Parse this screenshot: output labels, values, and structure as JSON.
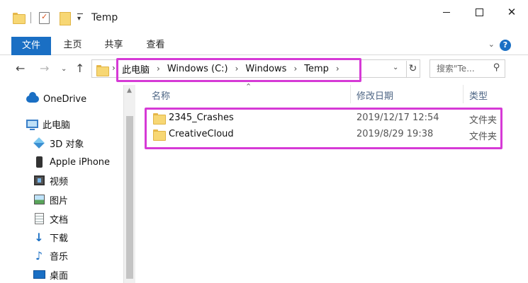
{
  "window": {
    "title": "Temp",
    "controls": {
      "minimize": "",
      "maximize": "",
      "close": "✕"
    }
  },
  "ribbon": {
    "tabs": [
      "文件",
      "主页",
      "共享",
      "查看"
    ],
    "active_tab": "文件",
    "accent": "#1a6fc4"
  },
  "address": {
    "crumbs": [
      "此电脑",
      "Windows (C:)",
      "Windows",
      "Temp"
    ],
    "separator": "›"
  },
  "search": {
    "placeholder": "搜索\"Te..."
  },
  "nav_pane": {
    "items": [
      {
        "label": "OneDrive",
        "icon": "onedrive-cloud-icon"
      },
      {
        "label": "此电脑",
        "icon": "computer-icon"
      },
      {
        "label": "3D 对象",
        "icon": "3d-objects-icon"
      },
      {
        "label": "Apple iPhone",
        "icon": "iphone-icon"
      },
      {
        "label": "视频",
        "icon": "video-icon"
      },
      {
        "label": "图片",
        "icon": "pictures-icon"
      },
      {
        "label": "文档",
        "icon": "documents-icon"
      },
      {
        "label": "下载",
        "icon": "download-icon"
      },
      {
        "label": "音乐",
        "icon": "music-icon"
      },
      {
        "label": "桌面",
        "icon": "desktop-icon"
      }
    ]
  },
  "file_list": {
    "columns": {
      "name": "名称",
      "date": "修改日期",
      "type": "类型"
    },
    "rows": [
      {
        "name": "2345_Crashes",
        "date": "2019/12/17 12:54",
        "type": "文件夹"
      },
      {
        "name": "CreativeCloud",
        "date": "2019/8/29 19:38",
        "type": "文件夹"
      }
    ]
  },
  "annotation_color": "#d63ad6"
}
